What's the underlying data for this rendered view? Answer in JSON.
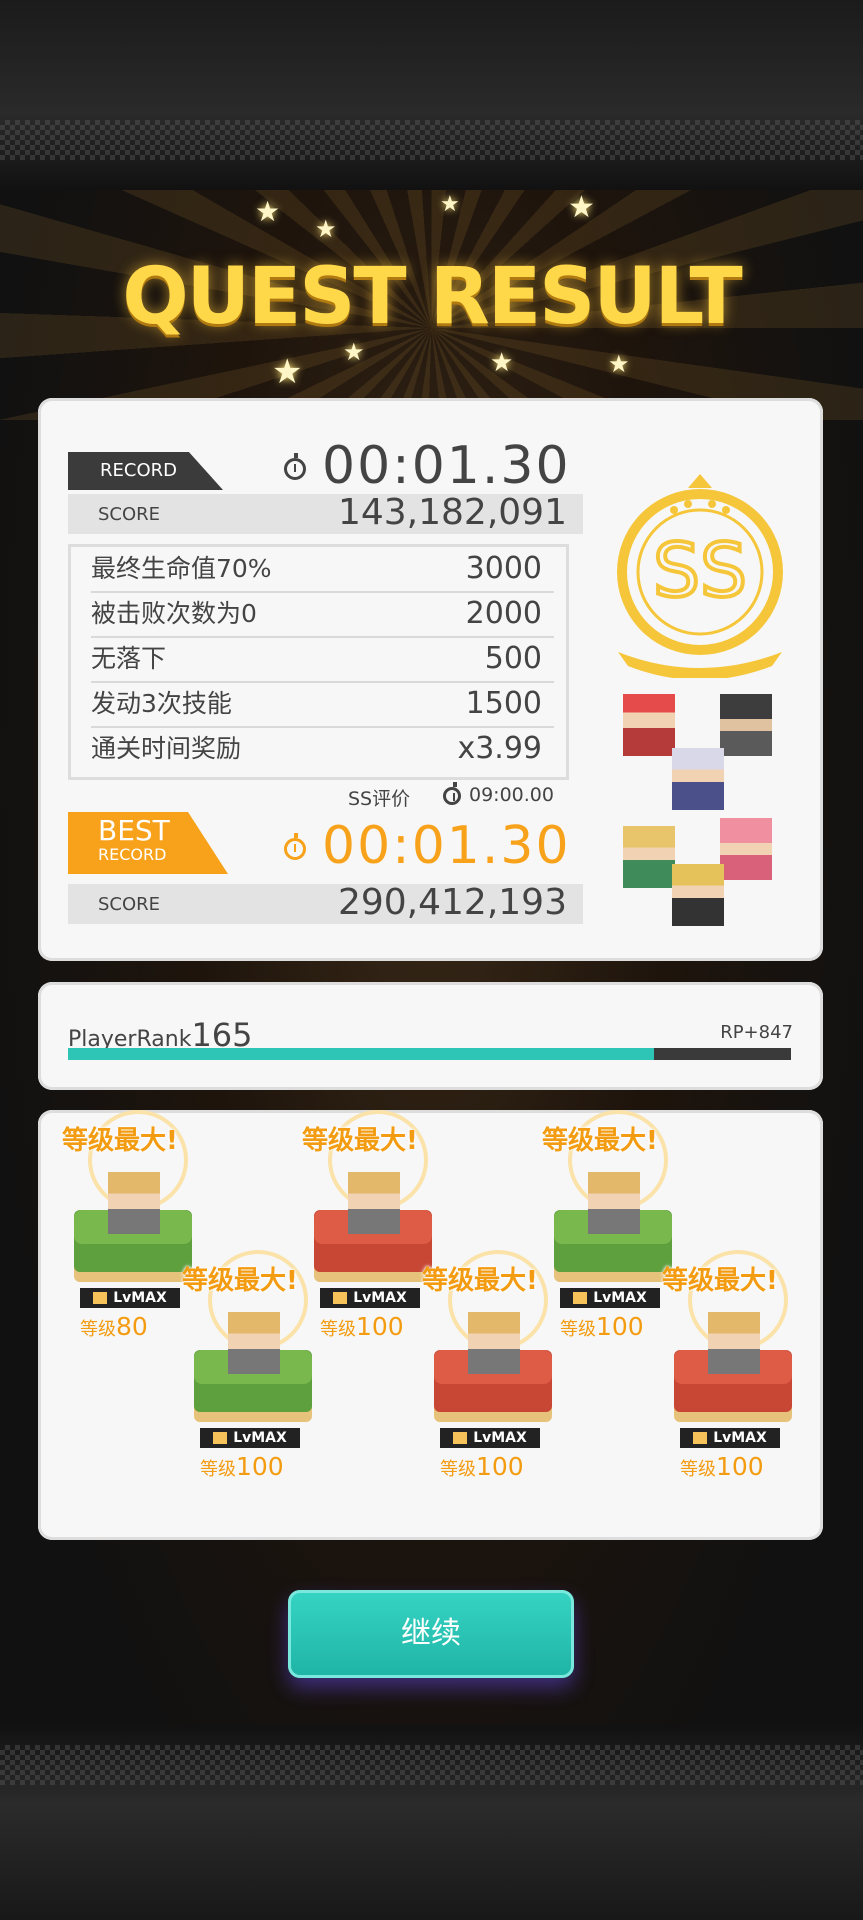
{
  "title": "QUEST RESULT",
  "record": {
    "label": "RECORD",
    "time": "00:01.30",
    "score_label": "SCORE",
    "score": "143,182,091"
  },
  "bonuses": [
    {
      "label": "最终生命值70%",
      "value": "3000"
    },
    {
      "label": "被击败次数为0",
      "value": "2000"
    },
    {
      "label": "无落下",
      "value": "500"
    },
    {
      "label": "发动3次技能",
      "value": "1500"
    },
    {
      "label": "通关时间奖励",
      "value": "x3.99"
    }
  ],
  "ss_rating": {
    "label": "SS评价",
    "time": "09:00.00",
    "grade": "SS"
  },
  "best": {
    "label_main": "BEST",
    "label_sub": "RECORD",
    "time": "00:01.30",
    "score_label": "SCORE",
    "score": "290,412,193"
  },
  "player": {
    "rank_label": "PlayerRank",
    "rank": "165",
    "rp": "RP+847",
    "progress": 0.81
  },
  "units": [
    {
      "max_text": "等级最大!",
      "badge": "LvMAX",
      "level_label": "等级",
      "level": "80",
      "base_color": "#5e9f3e",
      "top_color": "#79b84c"
    },
    {
      "max_text": "等级最大!",
      "badge": "LvMAX",
      "level_label": "等级",
      "level": "100",
      "base_color": "#5e9f3e",
      "top_color": "#79b84c"
    },
    {
      "max_text": "等级最大!",
      "badge": "LvMAX",
      "level_label": "等级",
      "level": "100",
      "base_color": "#c74634",
      "top_color": "#de5b45"
    },
    {
      "max_text": "等级最大!",
      "badge": "LvMAX",
      "level_label": "等级",
      "level": "100",
      "base_color": "#c74634",
      "top_color": "#de5b45"
    },
    {
      "max_text": "等级最大!",
      "badge": "LvMAX",
      "level_label": "等级",
      "level": "100",
      "base_color": "#5e9f3e",
      "top_color": "#79b84c"
    },
    {
      "max_text": "等级最大!",
      "badge": "LvMAX",
      "level_label": "等级",
      "level": "100",
      "base_color": "#c74634",
      "top_color": "#de5b45"
    }
  ],
  "continue_button": "继续",
  "colors": {
    "accent": "#f7a21a",
    "teal": "#2ec4b6",
    "gold": "#ffd84a"
  }
}
